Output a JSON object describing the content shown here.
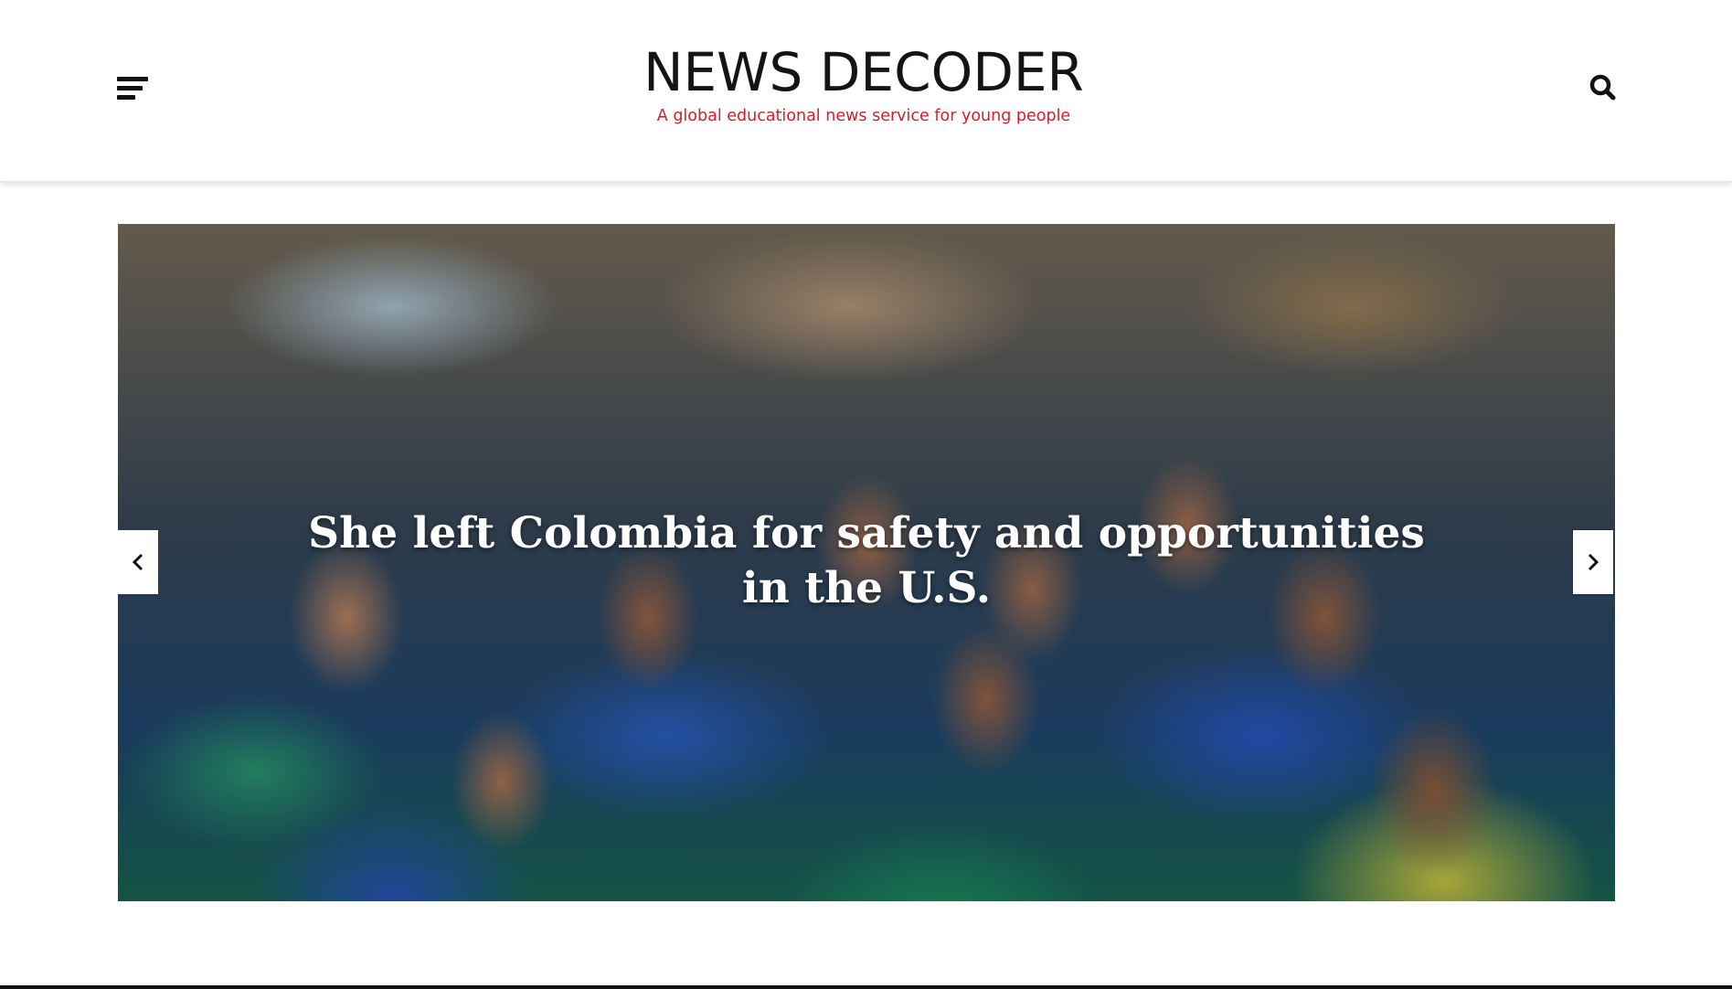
{
  "header": {
    "logo_title": "NEWS DECODER",
    "logo_tagline": "A global educational news service for young people",
    "menu_icon": "hamburger-menu-icon",
    "search_icon": "search-icon"
  },
  "slider": {
    "slide_title": "She left Colombia for safety and opportunities in the U.S.",
    "prev_icon": "chevron-left-icon",
    "next_icon": "chevron-right-icon"
  },
  "colors": {
    "brand_text": "#141414",
    "tagline_red": "#d2202f",
    "overlay_text": "#ffffff"
  }
}
